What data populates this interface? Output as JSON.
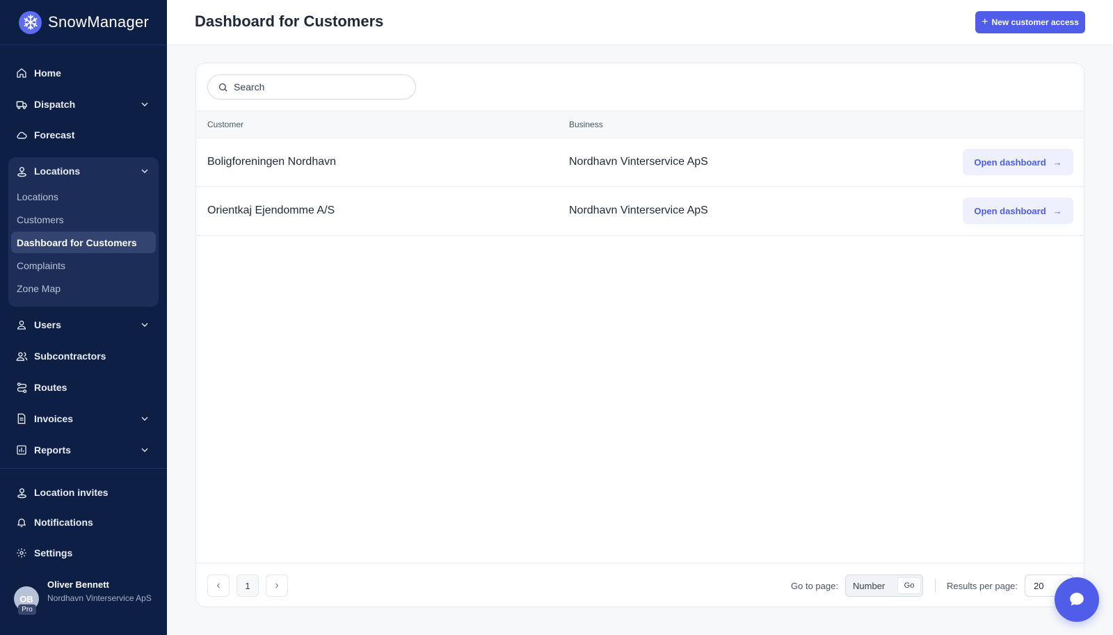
{
  "app": {
    "brand_name": "SnowManager"
  },
  "sidebar": {
    "items": [
      {
        "label": "Home",
        "icon": "home-icon"
      },
      {
        "label": "Dispatch",
        "icon": "truck-icon",
        "expandable": true
      },
      {
        "label": "Forecast",
        "icon": "cloud-icon"
      },
      {
        "label": "Locations",
        "icon": "location-pin-icon",
        "expandable": true,
        "expanded": true
      },
      {
        "label": "Users",
        "icon": "user-icon",
        "expandable": true
      },
      {
        "label": "Subcontractors",
        "icon": "users-icon"
      },
      {
        "label": "Routes",
        "icon": "route-icon"
      },
      {
        "label": "Invoices",
        "icon": "document-icon",
        "expandable": true
      },
      {
        "label": "Reports",
        "icon": "bar-chart-icon",
        "expandable": true
      }
    ],
    "locations_sub": [
      "Locations",
      "Customers",
      "Dashboard for Customers",
      "Complaints",
      "Zone Map"
    ],
    "active_sub": "Dashboard for Customers",
    "bottom_items": [
      {
        "label": "Location invites",
        "icon": "location-pin-icon"
      },
      {
        "label": "Notifications",
        "icon": "bell-icon"
      },
      {
        "label": "Settings",
        "icon": "gear-icon"
      }
    ],
    "user": {
      "initials": "OB",
      "badge": "Pro",
      "name": "Oliver Bennett",
      "business": "Nordhavn Vinterservice ApS"
    }
  },
  "header": {
    "title": "Dashboard for Customers",
    "new_button": "New customer access"
  },
  "search": {
    "placeholder": "Search"
  },
  "table": {
    "columns": [
      "Customer",
      "Business"
    ],
    "rows": [
      {
        "customer": "Boligforeningen Nordhavn",
        "business": "Nordhavn Vinterservice ApS",
        "action": "Open dashboard"
      },
      {
        "customer": "Orientkaj Ejendomme A/S",
        "business": "Nordhavn Vinterservice ApS",
        "action": "Open dashboard"
      }
    ]
  },
  "pagination": {
    "current_page": "1",
    "goto_label": "Go to page:",
    "goto_placeholder": "Number",
    "go_button": "Go",
    "rpp_label": "Results per page:",
    "rpp_value": "20"
  },
  "colors": {
    "sidebar_bg": "#0e1f45",
    "accent": "#4f5de8"
  }
}
